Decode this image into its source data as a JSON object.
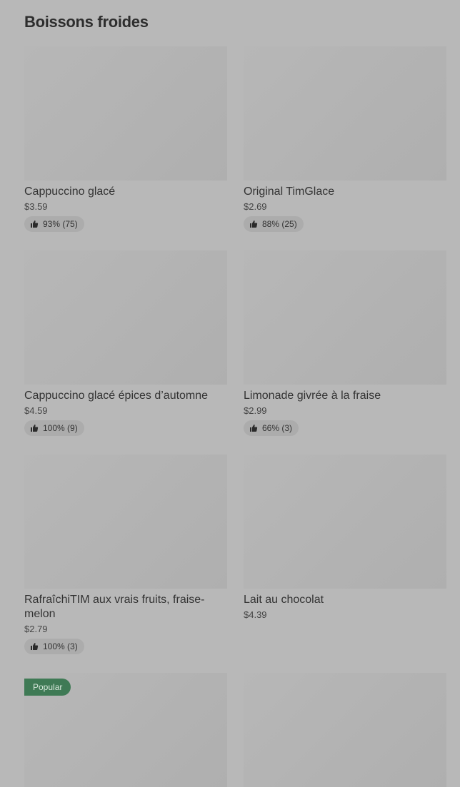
{
  "section": {
    "title": "Boissons froides"
  },
  "items": [
    {
      "name": "Cappuccino glacé",
      "price": "$3.59",
      "rating": "93% (75)"
    },
    {
      "name": "Original TimGlace",
      "price": "$2.69",
      "rating": "88% (25)"
    },
    {
      "name": "Cappuccino glacé épices d’automne",
      "price": "$4.59",
      "rating": "100% (9)"
    },
    {
      "name": "Limonade givrée à la fraise",
      "price": "$2.99",
      "rating": "66% (3)"
    },
    {
      "name": "RafraîchiTIM aux vrais fruits, fraise-melon",
      "price": "$2.79",
      "rating": "100% (3)"
    },
    {
      "name": "Lait au chocolat",
      "price": "$4.39"
    },
    {
      "badge": "Popular"
    },
    {}
  ]
}
